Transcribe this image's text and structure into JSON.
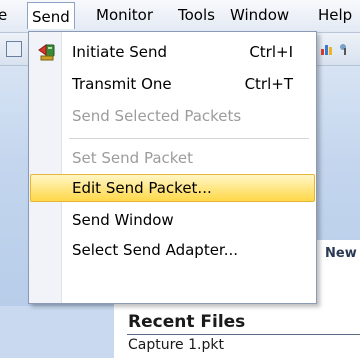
{
  "menubar": {
    "items": [
      {
        "label": "e"
      },
      {
        "label": "Send"
      },
      {
        "label": "Monitor"
      },
      {
        "label": "Tools"
      },
      {
        "label": "Window"
      },
      {
        "label": "Help"
      }
    ]
  },
  "send_menu": {
    "items": [
      {
        "label": "Initiate Send",
        "shortcut": "Ctrl+I",
        "icon": "initiate-send-icon"
      },
      {
        "label": "Transmit One",
        "shortcut": "Ctrl+T"
      },
      {
        "label": "Send Selected Packets",
        "disabled": true
      },
      {
        "label": "Set Send Packet",
        "disabled": true
      },
      {
        "label": "Edit Send Packet...",
        "highlighted": true
      },
      {
        "label": "Send Window"
      },
      {
        "label": "Select Send Adapter..."
      }
    ]
  },
  "start_page": {
    "new_label": "New",
    "recent_files_title": "Recent Files",
    "recent_files": [
      "Capture 1.pkt"
    ]
  },
  "colors": {
    "highlight_top": "#fff6c5",
    "highlight_bottom": "#ffd84a",
    "disabled_text": "#9c9c9c"
  }
}
